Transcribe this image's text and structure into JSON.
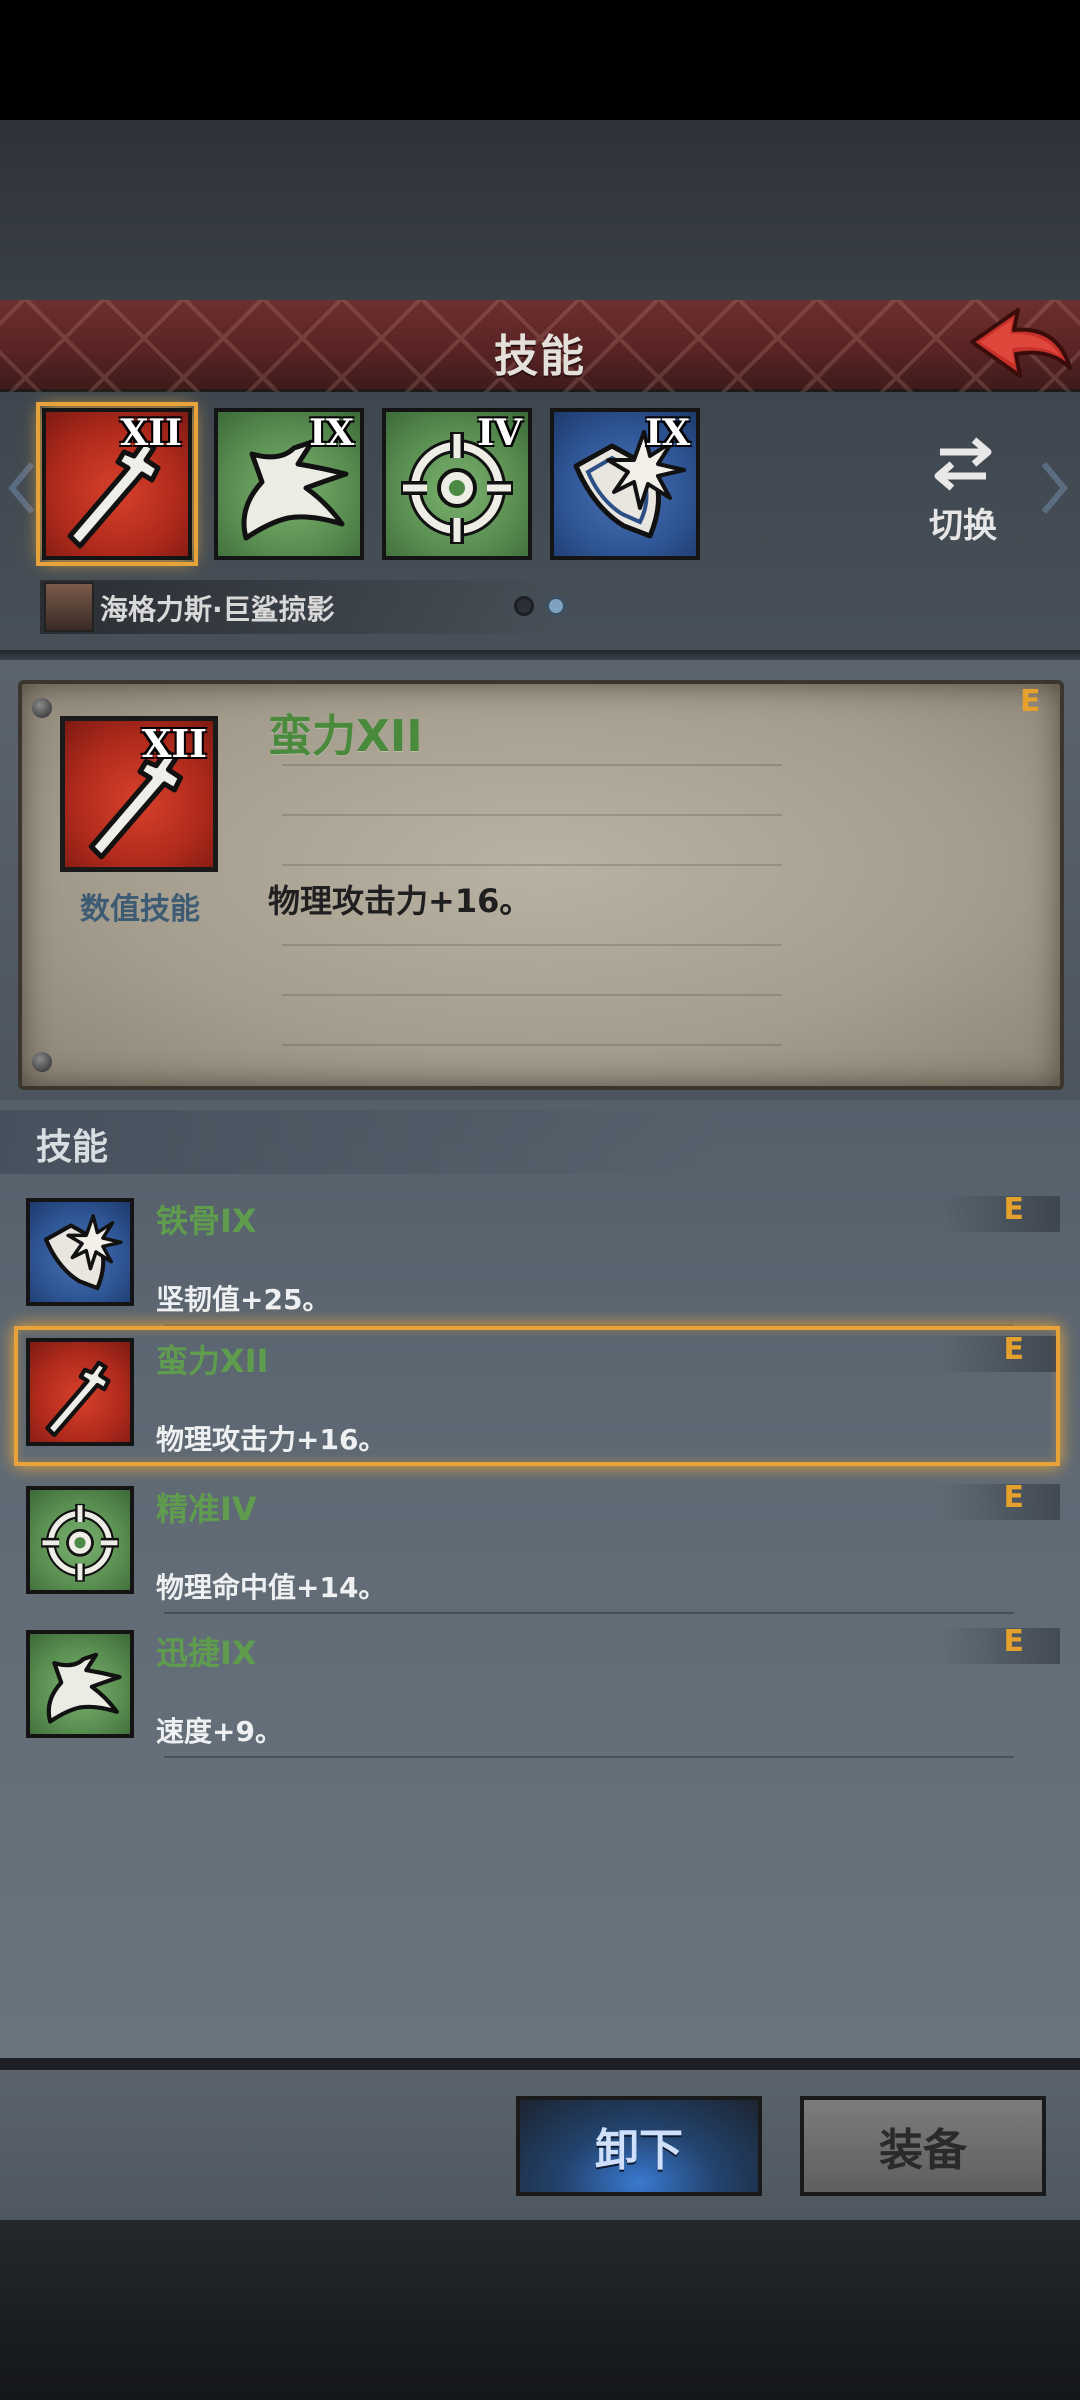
{
  "header": {
    "title": "技能"
  },
  "top_skills": [
    {
      "roman": "XII",
      "color": "red",
      "icon": "sword-icon"
    },
    {
      "roman": "IX",
      "color": "green",
      "icon": "swift-icon"
    },
    {
      "roman": "IV",
      "color": "green",
      "icon": "crosshair-icon"
    },
    {
      "roman": "IX",
      "color": "blue",
      "icon": "shield-burst-icon"
    }
  ],
  "swap": {
    "label": "切换",
    "icon": "swap-arrows-icon"
  },
  "hero": {
    "name": "海格力斯·巨鲨掠影"
  },
  "pager": {
    "pages": 2,
    "active": 2
  },
  "detail": {
    "name": "蛮力XII",
    "rank": "E",
    "type": "数值技能",
    "description": "物理攻击力+16。",
    "icon": "sword-icon",
    "roman": "XII"
  },
  "section": {
    "title": "技能"
  },
  "skills": [
    {
      "name": "铁骨IX",
      "description": "坚韧值+25。",
      "rank": "E",
      "roman": "IX",
      "color": "blue",
      "icon": "shield-burst-icon"
    },
    {
      "name": "蛮力XII",
      "description": "物理攻击力+16。",
      "rank": "E",
      "roman": "XII",
      "color": "red",
      "icon": "sword-icon",
      "selected": true
    },
    {
      "name": "精准IV",
      "description": "物理命中值+14。",
      "rank": "E",
      "roman": "IV",
      "color": "green",
      "icon": "crosshair-icon"
    },
    {
      "name": "迅捷IX",
      "description": "速度+9。",
      "rank": "E",
      "roman": "IX",
      "color": "green",
      "icon": "swift-icon"
    }
  ],
  "buttons": {
    "unequip": "卸下",
    "equip": "装备"
  },
  "colors": {
    "accent": "#e8a23a",
    "skill_name": "#5f9c4d",
    "rank": "#e6a02c",
    "header": "#5a2424"
  }
}
